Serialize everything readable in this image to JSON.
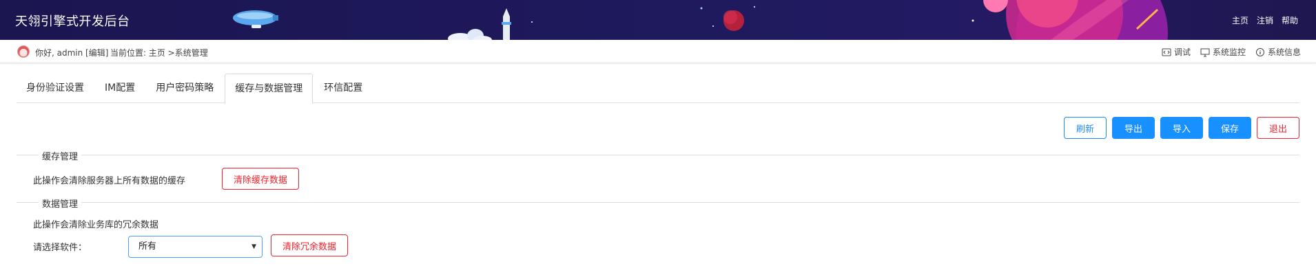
{
  "header": {
    "app_title": "天翎引擎式开发后台",
    "nav": [
      "主页",
      "注销",
      "帮助"
    ]
  },
  "subbar": {
    "greeting": "你好, admin [编辑]",
    "location": "当前位置: 主页 >系统管理",
    "tools": [
      {
        "icon": "code-icon",
        "label": "调试"
      },
      {
        "icon": "monitor-icon",
        "label": "系统监控"
      },
      {
        "icon": "info-icon",
        "label": "系统信息"
      }
    ]
  },
  "tabs": [
    {
      "label": "身份验证设置",
      "active": false
    },
    {
      "label": "IM配置",
      "active": false
    },
    {
      "label": "用户密码策略",
      "active": false
    },
    {
      "label": "缓存与数据管理",
      "active": true
    },
    {
      "label": "环信配置",
      "active": false
    }
  ],
  "actions": {
    "refresh": "刷新",
    "export": "导出",
    "import": "导入",
    "save": "保存",
    "exit": "退出"
  },
  "cache_section": {
    "legend": "缓存管理",
    "description": "此操作会清除服务器上所有数据的缓存",
    "button": "清除缓存数据"
  },
  "data_section": {
    "legend": "数据管理",
    "description": "此操作会清除业务库的冗余数据",
    "select_label": "请选择软件：",
    "select_value": "所有",
    "button": "清除冗余数据"
  },
  "colors": {
    "banner": "#1f1a5e",
    "primary": "#1890ff",
    "danger": "#f5222d"
  }
}
